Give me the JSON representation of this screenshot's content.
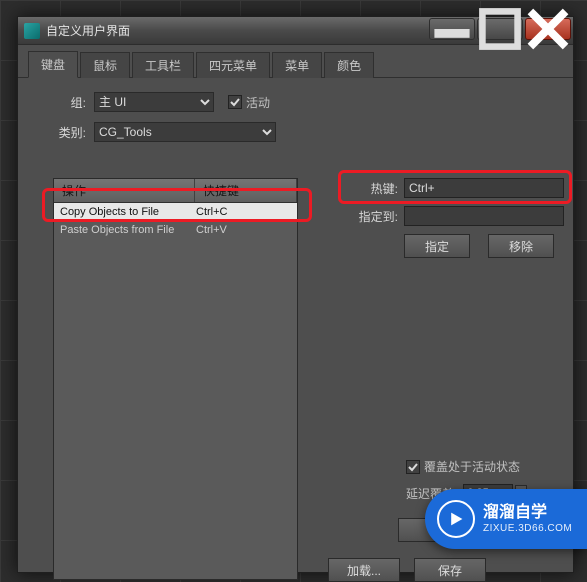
{
  "window": {
    "title": "自定义用户界面"
  },
  "tabs": {
    "keyboard": "键盘",
    "mouse": "鼠标",
    "toolbar": "工具栏",
    "quad": "四元菜单",
    "menu": "菜单",
    "color": "颜色"
  },
  "form": {
    "group_label": "组:",
    "group_value": "主 UI",
    "active_label": "活动",
    "category_label": "类别:",
    "category_value": "CG_Tools"
  },
  "list": {
    "col_action": "操作",
    "col_key": "快捷键",
    "rows": [
      {
        "action": "Copy Objects to File",
        "key": "Ctrl+C",
        "selected": true
      },
      {
        "action": "Paste Objects from File",
        "key": "Ctrl+V",
        "selected": false
      }
    ]
  },
  "right": {
    "hotkey_label": "热键:",
    "hotkey_value": "Ctrl+",
    "assignto_label": "指定到:",
    "assign_btn": "指定",
    "remove_btn": "移除"
  },
  "bottom": {
    "override_label": "覆盖处于活动状态",
    "delay_label": "延迟覆盖:",
    "delay_value": "0.25"
  },
  "footer": {
    "load": "加载...",
    "save": "保存"
  },
  "bubble": {
    "line1": "溜溜自学",
    "line2": "ZIXUE.3D66.COM"
  }
}
